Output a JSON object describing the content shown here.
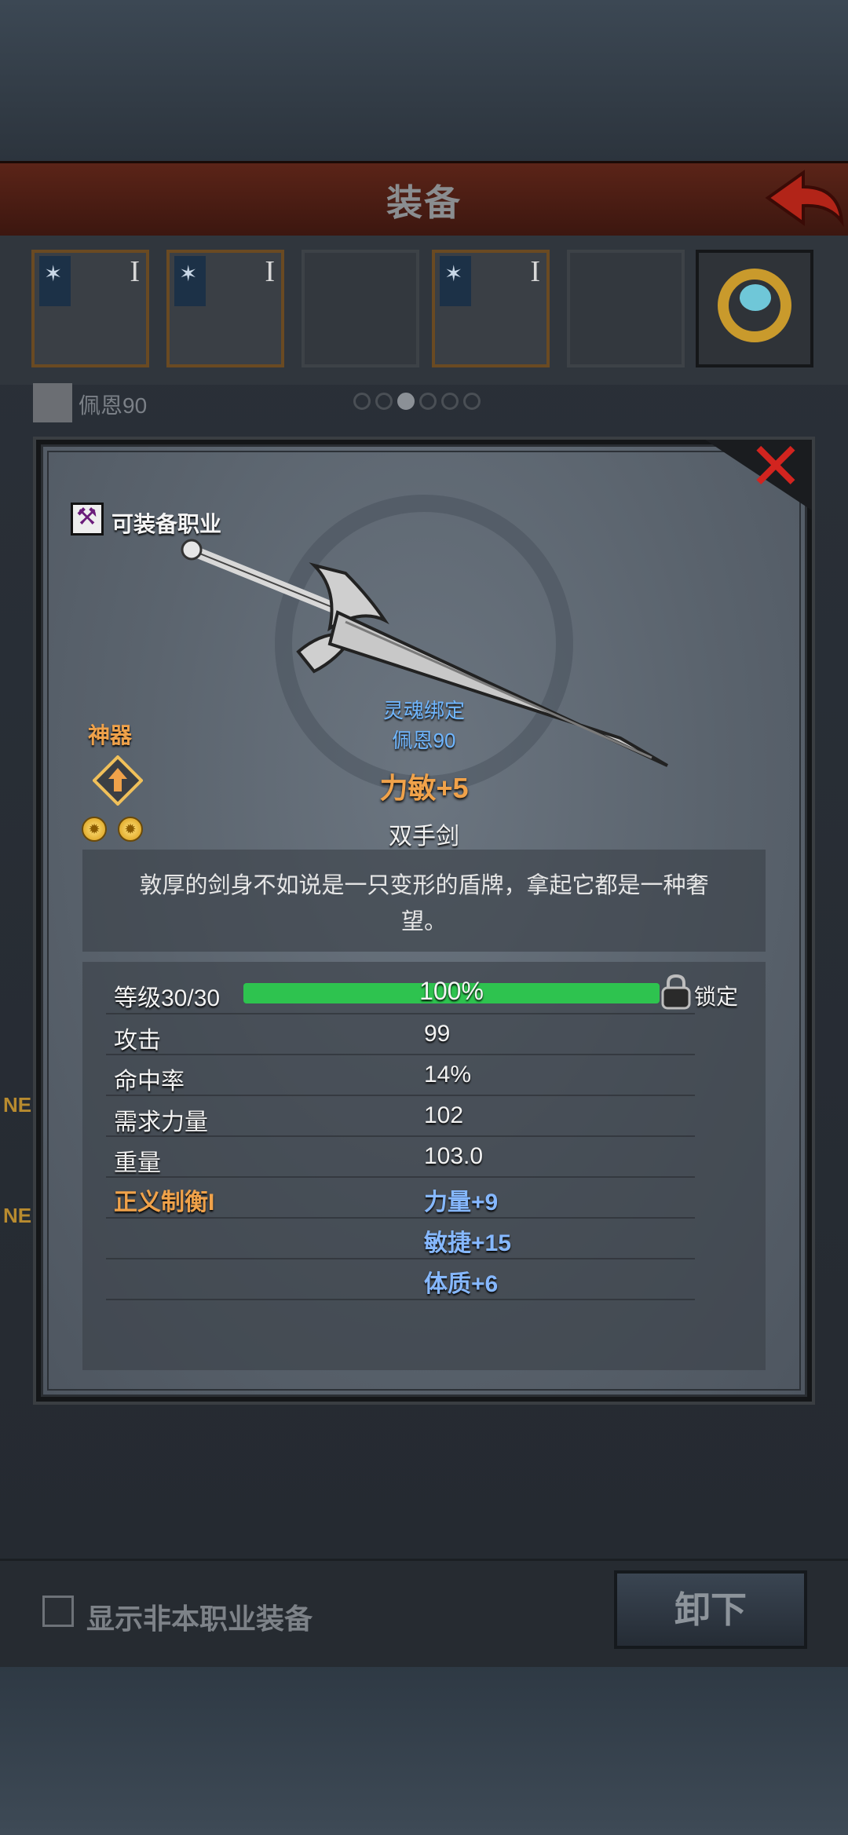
{
  "header": {
    "title": "装备"
  },
  "slots": [
    {
      "tier": "I",
      "state": "selected"
    },
    {
      "tier": "I",
      "state": "equipped"
    },
    {
      "tier": "",
      "state": "empty"
    },
    {
      "tier": "I",
      "state": "equipped"
    },
    {
      "tier": "",
      "state": "empty"
    },
    {
      "tier": "",
      "state": "ring"
    }
  ],
  "character": {
    "name": "佩恩90"
  },
  "pager": {
    "count": 6,
    "active_index": 2
  },
  "side_tags": [
    "NE",
    "NE"
  ],
  "item": {
    "class_label": "可装备职业",
    "artifact_label": "神器",
    "bind_label": "灵魂绑定",
    "bind_owner": "佩恩90",
    "affix": "力敏+5",
    "weapon_type": "双手剑",
    "description": "敦厚的剑身不如说是一只变形的盾牌，拿起它都是一种奢望。"
  },
  "level": {
    "label": "等级30/30",
    "percent_text": "100%",
    "fill": 1.0,
    "lock_label": "锁定"
  },
  "stats": [
    {
      "label": "攻击",
      "value": "99"
    },
    {
      "label": "命中率",
      "value": "14%"
    },
    {
      "label": "需求力量",
      "value": "102"
    },
    {
      "label": "重量",
      "value": "103.0"
    }
  ],
  "set_bonus": {
    "label": "正义制衡I",
    "values": [
      "力量+9",
      "敏捷+15",
      "体质+6"
    ]
  },
  "bottom": {
    "checkbox_label": "显示非本职业装备",
    "unequip_label": "卸下"
  },
  "colors": {
    "accent_orange": "#f0a24a",
    "bind_blue": "#6fb6ff",
    "bonus_blue": "#86b8ff",
    "bar_green": "#2ec34f",
    "close_red": "#d2241f"
  }
}
